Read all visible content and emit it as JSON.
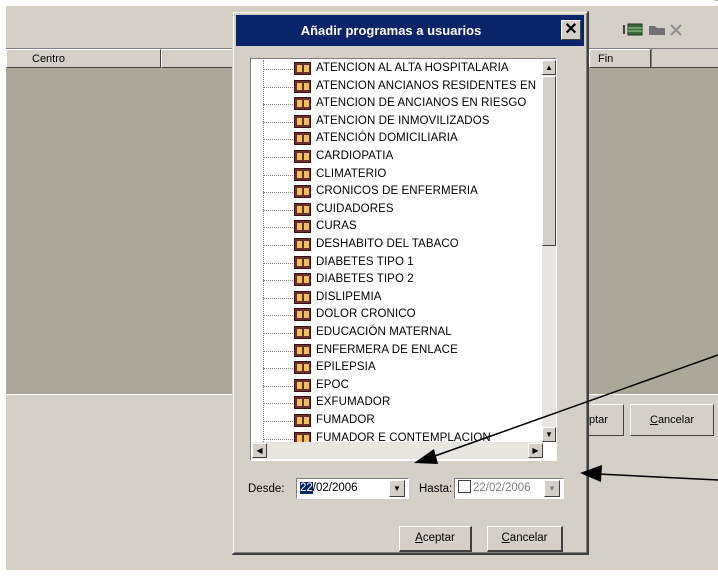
{
  "background_window": {
    "columns": [
      "Centro",
      "",
      "Fin"
    ],
    "accept_partial": "ptar",
    "cancel_label_first": "C",
    "cancel_label_rest": "ancelar",
    "toolbar_icons": [
      "grid-icon",
      "folder-icon",
      "close-icon"
    ]
  },
  "dialog": {
    "title": "Añadir programas a usuarios",
    "close_glyph": "✕",
    "programs": [
      "ATENCION AL ALTA HOSPITALARIA",
      "ATENCION ANCIANOS RESIDENTES EN",
      "ATENCION DE ANCIANOS EN RIESGO",
      "ATENCION DE INMOVILIZADOS",
      "ATENCIÓN DOMICILIARIA",
      "CARDIOPATIA",
      "CLIMATERIO",
      "CRONICOS DE ENFERMERIA",
      "CUIDADORES",
      "CURAS",
      "DESHABITO DEL TABACO",
      "DIABETES TIPO 1",
      "DIABETES TIPO 2",
      "DISLIPEMIA",
      "DOLOR CRONICO",
      "EDUCACIÓN MATERNAL",
      "ENFERMERA DE ENLACE",
      "EPILEPSIA",
      "EPOC",
      "EXFUMADOR",
      "FUMADOR",
      "FUMADOR E CONTEMPLACION"
    ],
    "desde_label": "Desde:",
    "desde_day": "22",
    "desde_rest": "/02/2006",
    "hasta_label": "Hasta:",
    "hasta_value": "22/02/2006",
    "hasta_checked": false,
    "accept_first": "A",
    "accept_rest": "ceptar",
    "cancel_first": "C",
    "cancel_rest": "ancelar"
  },
  "colors": {
    "titlebar": "#0a246a",
    "face": "#d4d0c8",
    "grid_bg": "#aca899",
    "selection": "#0a246a"
  }
}
